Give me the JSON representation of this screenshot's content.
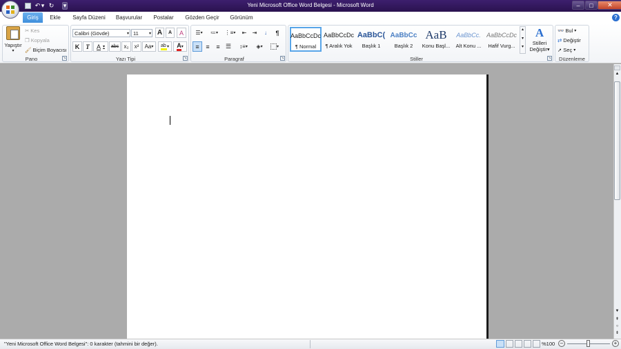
{
  "window": {
    "title": "Yeni Microsoft Office Word Belgesi - Microsoft Word",
    "controls": {
      "minimize": "–",
      "maximize": "□",
      "close": "✕"
    }
  },
  "qat": {
    "save": "💾",
    "undo": "↶",
    "undo_drop": "▾",
    "redo": "↻",
    "customize": "▾"
  },
  "tabs": [
    "Giriş",
    "Ekle",
    "Sayfa Düzeni",
    "Başvurular",
    "Postalar",
    "Gözden Geçir",
    "Görünüm"
  ],
  "ribbon": {
    "clipboard": {
      "label": "Pano",
      "paste": "Yapıştır",
      "cut": "Kes",
      "copy": "Kopyala",
      "format_painter": "Biçim Boyacısı"
    },
    "font": {
      "label": "Yazı Tipi",
      "font_name": "Calibri (Gövde)",
      "font_size": "11",
      "bold": "K",
      "italic": "T",
      "underline": "A",
      "strike": "abc",
      "subscript": "x₂",
      "superscript": "x²",
      "change_case": "Aa",
      "grow": "A",
      "shrink": "A",
      "clear": "A"
    },
    "paragraph": {
      "label": "Paragraf",
      "pilcrow": "¶"
    },
    "styles": {
      "label": "Stiller",
      "items": [
        {
          "preview": "AaBbCcDc",
          "name": "¶ Normal"
        },
        {
          "preview": "AaBbCcDc",
          "name": "¶ Aralık Yok"
        },
        {
          "preview": "AaBbC(",
          "name": "Başlık 1"
        },
        {
          "preview": "AaBbCc",
          "name": "Başlık 2"
        },
        {
          "preview": "AaB",
          "name": "Konu Başl..."
        },
        {
          "preview": "AaBbCc.",
          "name": "Alt Konu ..."
        },
        {
          "preview": "AaBbCcDc",
          "name": "Hafif Vurg..."
        }
      ],
      "change_styles_line1": "Stilleri",
      "change_styles_line2": "Değiştir"
    },
    "editing": {
      "label": "Düzenleme",
      "find": "Bul",
      "replace": "Değiştir",
      "select": "Seç"
    }
  },
  "status": {
    "text": "\"Yeni Microsoft Office Word Belgesi\": 0 karakter (tahmini bir değer).",
    "zoom": "%100"
  },
  "colors": {
    "accent": "#3f8fdc",
    "titlebar": "#2f1860",
    "highlight": "#f3f300",
    "font_color": "#e02020"
  }
}
